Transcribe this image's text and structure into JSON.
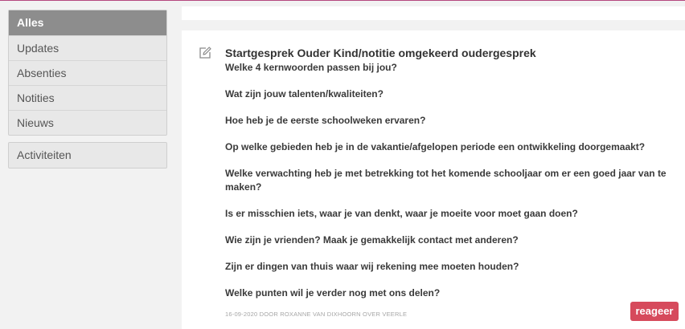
{
  "sidebar": {
    "items": [
      {
        "label": "Alles",
        "active": true
      },
      {
        "label": "Updates"
      },
      {
        "label": "Absenties"
      },
      {
        "label": "Notities"
      },
      {
        "label": "Nieuws"
      }
    ],
    "secondary": {
      "label": "Activiteiten"
    }
  },
  "post": {
    "icon": "edit-note-icon",
    "title": "Startgesprek Ouder Kind/notitie omgekeerd oudergesprek",
    "questions": [
      "Welke 4 kernwoorden passen bij jou?",
      "Wat zijn jouw talenten/kwaliteiten?",
      "Hoe heb je de eerste schoolweken ervaren?",
      "Op welke gebieden heb je in de vakantie/afgelopen periode een ontwikkeling doorgemaakt?",
      "Welke verwachting heb je met betrekking tot het komende schooljaar om er een goed jaar van te maken?",
      "Is er misschien iets, waar je van denkt, waar je moeite voor moet gaan doen?",
      "Wie zijn je vrienden? Maak je gemakkelijk contact met anderen?",
      "Zijn er dingen van thuis waar wij rekening mee moeten houden?",
      "Welke punten wil je verder nog met ons delen?"
    ],
    "meta": "16-09-2020 DOOR ROXANNE VAN DIXHOORN OVER VEERLE",
    "reply_label": "reageer"
  },
  "colors": {
    "accent_button": "#d64a5c",
    "active_sidebar": "#8d8d8d",
    "top_line": "#b5477f"
  }
}
